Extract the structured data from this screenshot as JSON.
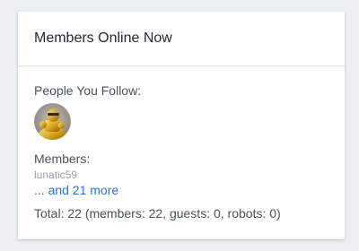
{
  "widget": {
    "title": "Members Online Now",
    "follow_label": "People You Follow:",
    "followed_avatar_icon": "gold-statue-avatar",
    "members_label": "Members:",
    "members": [
      "lunatic59"
    ],
    "more_prefix": "...",
    "more_link": "and 21 more",
    "total": "Total: 22 (members: 22, guests: 0, robots: 0)"
  },
  "colors": {
    "link": "#2577c9",
    "muted": "#98a1ad",
    "text": "#47525f",
    "background": "#ebeef2"
  }
}
